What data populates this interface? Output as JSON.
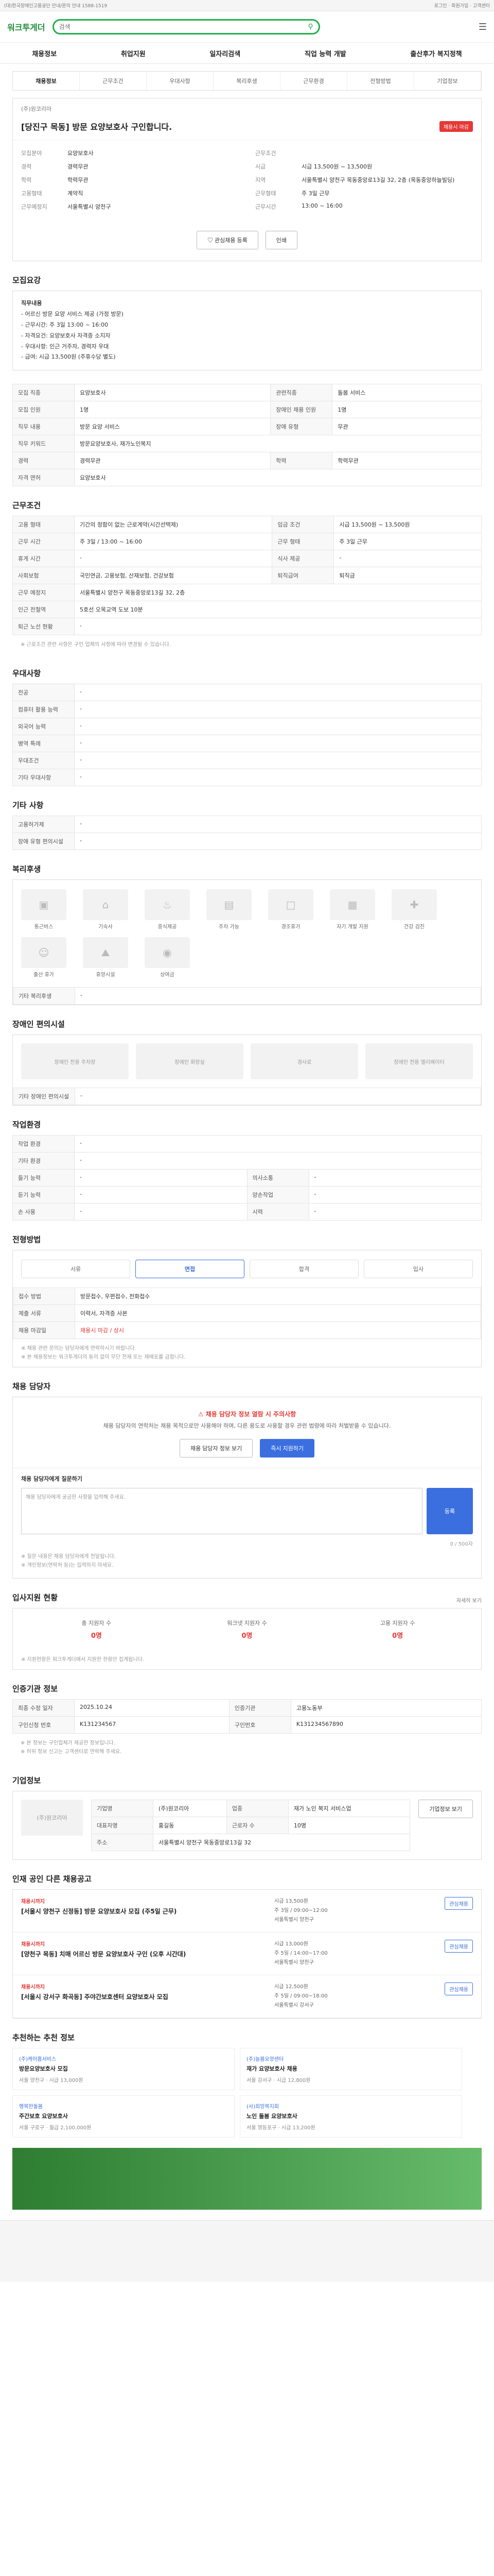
{
  "top": {
    "left": "(대)한국장애인고용공단 안내/문의 안내 1588-1519",
    "right": "로그인 · 회원가입 · 고객센터"
  },
  "header": {
    "logo": "워크투게더",
    "search_placeholder": "검색",
    "menu_icon_label": "메뉴"
  },
  "nav": {
    "items": [
      "채용정보",
      "취업지원",
      "일자리검색",
      "직업 능력 개발",
      "출산후가 복지정책"
    ]
  },
  "breadcrumb": {
    "items": [
      "채용정보",
      "근무조건",
      "우대사항",
      "복리후생",
      "근무환경",
      "전형방법",
      "기업정보"
    ]
  },
  "job": {
    "company": "(주)원코리아",
    "title": "[당진구 목동] 방문 요양보호사 구인합니다.",
    "status": "채용시 마감",
    "left_info": [
      {
        "k": "모집분야",
        "v": "요양보호사"
      },
      {
        "k": "경력",
        "v": "경력무관"
      },
      {
        "k": "학력",
        "v": "학력무관"
      },
      {
        "k": "고용형태",
        "v": "계약직"
      },
      {
        "k": "근무예정지",
        "v": "서울특별시 양천구"
      }
    ],
    "right_info": [
      {
        "k": "근무조건",
        "v": ""
      },
      {
        "k": "시급",
        "v": "시급 13,500원 ~ 13,500원"
      },
      {
        "k": "지역",
        "v": "서울특별시 양천구 목동중앙로13길 32, 2층 (목동중앙하늘빌딩)"
      },
      {
        "k": "근무형태",
        "v": "주 3일 근무"
      },
      {
        "k": "근무시간",
        "v": "13:00 ~ 16:00"
      }
    ],
    "btn_scrap": "관심채용 등록",
    "btn_print": "인쇄"
  },
  "summary": {
    "title": "모집요강",
    "lines": [
      "직무내용",
      "- 어르신 방문 요양 서비스 제공 (가정 방문)",
      "- 근무시간: 주 3일 13:00 ~ 16:00",
      "- 자격요건: 요양보호사 자격증 소지자",
      "- 우대사항: 인근 거주자, 경력자 우대",
      "- 급여: 시급 13,500원 (주휴수당 별도)"
    ]
  },
  "recruit_table": [
    {
      "k": "모집 직종",
      "v": "요양보호사",
      "k2": "관련직종",
      "v2": "돌봄 서비스"
    },
    {
      "k": "모집 인원",
      "v": "1명",
      "k2": "장애인 채용 인원",
      "v2": "1명"
    },
    {
      "k": "직무 내용",
      "v": "방문 요양 서비스",
      "k2": "장애 유형",
      "v2": "무관"
    },
    {
      "k": "직무 키워드",
      "v": "방문요양보호사, 재가노인복지",
      "k2": "",
      "v2": ""
    },
    {
      "k": "경력",
      "v": "경력무관",
      "k2": "학력",
      "v2": "학력무관"
    },
    {
      "k": "자격 면허",
      "v": "요양보호사",
      "k2": "",
      "v2": ""
    }
  ],
  "conditions_table": [
    {
      "k": "고용 형태",
      "v": "기간의 정함이 없는 근로계약(시간선택제)",
      "k2": "임금 조건",
      "v2": "시급 13,500원 ~ 13,500원"
    },
    {
      "k": "근무 시간",
      "v": "주 3일 / 13:00 ~ 16:00",
      "k2": "근무 형태",
      "v2": "주 3일 근무"
    },
    {
      "k": "휴게 시간",
      "v": "-",
      "k2": "식사 제공",
      "v2": "-"
    },
    {
      "k": "사회보험",
      "v": "국민연금, 고용보험, 산재보험, 건강보험",
      "k2": "퇴직급여",
      "v2": "퇴직금"
    },
    {
      "k": "근무 예정지",
      "v": "서울특별시 양천구 목동중앙로13길 32, 2층",
      "k2": "",
      "v2": ""
    },
    {
      "k": "인근 전철역",
      "v": "5호선 오목교역 도보 10분",
      "k2": "",
      "v2": ""
    },
    {
      "k": "퇴근 노선 현황",
      "v": "-",
      "k2": "",
      "v2": ""
    }
  ],
  "conditions_note": "※ 근로조건 관련 사항은 구인 업체의 사정에 따라 변경될 수 있습니다.",
  "preferred": {
    "title": "우대사항",
    "rows": [
      {
        "k": "전공",
        "v": "-"
      },
      {
        "k": "컴퓨터 활용 능력",
        "v": "-"
      },
      {
        "k": "외국어 능력",
        "v": "-"
      },
      {
        "k": "병역 특례",
        "v": "-"
      },
      {
        "k": "우대조건",
        "v": "-"
      },
      {
        "k": "기타 우대사항",
        "v": "-"
      }
    ]
  },
  "other_conditions": {
    "title": "기타 사항",
    "rows": [
      {
        "k": "고용허가제",
        "v": "-"
      },
      {
        "k": "장애 유형 편의시설",
        "v": "-"
      }
    ]
  },
  "welfare": {
    "title": "복리후생",
    "items": [
      {
        "icon": "money-icon",
        "label": "통근버스"
      },
      {
        "icon": "house-icon",
        "label": "기숙사"
      },
      {
        "icon": "meal-icon",
        "label": "중식제공"
      },
      {
        "icon": "car-icon",
        "label": "주차 가능"
      },
      {
        "icon": "gift-icon",
        "label": "경조휴가"
      },
      {
        "icon": "book-icon",
        "label": "자기 개발 지원"
      },
      {
        "icon": "medical-icon",
        "label": "건강 검진"
      },
      {
        "icon": "baby-icon",
        "label": "출산 휴가"
      },
      {
        "icon": "trip-icon",
        "label": "휴양시설"
      },
      {
        "icon": "coin-icon",
        "label": "상여금"
      }
    ],
    "note": "기타 복리후생",
    "note_value": "-"
  },
  "facility": {
    "title": "장애인 편의시설",
    "items": [
      "장애인 전용 주차장",
      "장애인 화장실",
      "경사로",
      "장애인 전용 엘리베이터"
    ],
    "note": "기타 장애인 편의시설",
    "note_value": "-"
  },
  "environment": {
    "title": "작업환경",
    "rows": [
      {
        "k": "작업 환경",
        "v": "-",
        "k2": "",
        "v2": ""
      },
      {
        "k": "기타 환경",
        "v": "-",
        "k2": "",
        "v2": ""
      },
      {
        "k": "들기 능력",
        "v": "-",
        "k2": "의사소통",
        "v2": "-"
      },
      {
        "k": "듣기 능력",
        "v": "-",
        "k2": "양손작업",
        "v2": "-"
      },
      {
        "k": "손 사용",
        "v": "-",
        "k2": "시력",
        "v2": "-"
      }
    ]
  },
  "selection": {
    "title": "전형방법",
    "steps": [
      "서류",
      "면접",
      "합격",
      "입사"
    ],
    "rows": [
      {
        "k": "접수 방법",
        "v": "방문접수, 우편접수, 전화접수"
      },
      {
        "k": "제출 서류",
        "v": "이력서, 자격증 사본"
      },
      {
        "k": "채용 마감일",
        "v": "채용시 마감 / 상시"
      }
    ],
    "notes": [
      "※ 채용 관련 문의는 담당자에게 연락하시기 바랍니다.",
      "※ 본 채용정보는 워크투게더의 동의 없이 무단 전재 또는 재배포를 금합니다."
    ]
  },
  "apply": {
    "title": "채용 담당자",
    "banner_title": "채용 담당자 정보 열람 시 주의사항",
    "banner_sub": "채용 담당자의 연락처는 채용 목적으로만 사용해야 하며, 다른 용도로 사용할 경우 관련 법령에 따라 처벌받을 수 있습니다.",
    "btn_view": "채용 담당자 정보 보기",
    "btn_apply": "즉시 지원하기",
    "form_title": "채용 담당자에게 질문하기",
    "form_placeholder": "채용 담당자에게 궁금한 사항을 입력해 주세요.",
    "form_count": "0 / 500자",
    "form_submit": "등록",
    "notes": [
      "※ 질문 내용은 채용 담당자에게 전달됩니다.",
      "※ 개인정보(연락처 등)는 입력하지 마세요."
    ]
  },
  "stats": {
    "title": "입사지원 현황",
    "more": "자세히 보기",
    "items": [
      {
        "label": "총 지원자 수",
        "value": "0명"
      },
      {
        "label": "워크넷 지원자 수",
        "value": "0명"
      },
      {
        "label": "고용 지원자 수",
        "value": "0명"
      }
    ],
    "note": "※ 지원현황은 워크투게더에서 지원한 현황만 집계됩니다."
  },
  "contact_info": {
    "title": "인증기관 정보",
    "rows": [
      {
        "k": "최종 수정 일자",
        "v": "2025.10.24",
        "k2": "인증기관",
        "v2": "고용노동부"
      },
      {
        "k": "구인신청 번호",
        "v": "K131234567",
        "k2": "구인번호",
        "v2": "K131234567890"
      }
    ],
    "notes": [
      "※ 본 정보는 구인업체가 제공한 정보입니다.",
      "※ 허위 정보 신고는 고객센터로 연락해 주세요."
    ]
  },
  "company": {
    "title": "기업정보",
    "name": "(주)원코리아",
    "rows": [
      {
        "k": "기업명",
        "v": "(주)원코리아",
        "k2": "업종",
        "v2": "재가 노인 복지 서비스업"
      },
      {
        "k": "대표자명",
        "v": "홍길동",
        "k2": "근로자 수",
        "v2": "10명"
      },
      {
        "k": "주소",
        "v": "서울특별시 양천구 목동중앙로13길 32",
        "k2": "",
        "v2": ""
      }
    ],
    "btn_more": "기업정보 보기"
  },
  "similar": {
    "title": "인재 공인 다른 채용공고",
    "items": [
      {
        "company": "채용시까지",
        "title": "[서울시 양천구 신정동] 방문 요양보호사 모집 (주5일 근무)",
        "meta": [
          "시급 13,500원",
          "주 3일 / 09:00~12:00",
          "서울특별시 양천구"
        ],
        "btn": "관심채용"
      },
      {
        "company": "채용시까지",
        "title": "[양천구 목동] 치매 어르신 방문 요양보호사 구인 (오후 시간대)",
        "meta": [
          "시급 13,000원",
          "주 5일 / 14:00~17:00",
          "서울특별시 양천구"
        ],
        "btn": "관심채용"
      },
      {
        "company": "채용시까지",
        "title": "[서울시 강서구 화곡동] 주야간보호센터 요양보호사 모집",
        "meta": [
          "시급 12,500원",
          "주 5일 / 09:00~18:00",
          "서울특별시 강서구"
        ],
        "btn": "관심채용"
      }
    ]
  },
  "recommend": {
    "title": "추천하는 추천 정보",
    "cards": [
      {
        "company": "(주)케어홈서비스",
        "title": "방문요양보호사 모집",
        "meta": "서울 양천구 · 시급 13,000원"
      },
      {
        "company": "(주)늘봄요양센터",
        "title": "재가 요양보호사 채용",
        "meta": "서울 강서구 · 시급 12,800원"
      },
      {
        "company": "행복한돌봄",
        "title": "주간보호 요양보호사",
        "meta": "서울 구로구 · 월급 2,100,000원"
      },
      {
        "company": "(사)희망복지회",
        "title": "노인 돌봄 요양보호사",
        "meta": "서울 영등포구 · 시급 13,200원"
      }
    ]
  }
}
